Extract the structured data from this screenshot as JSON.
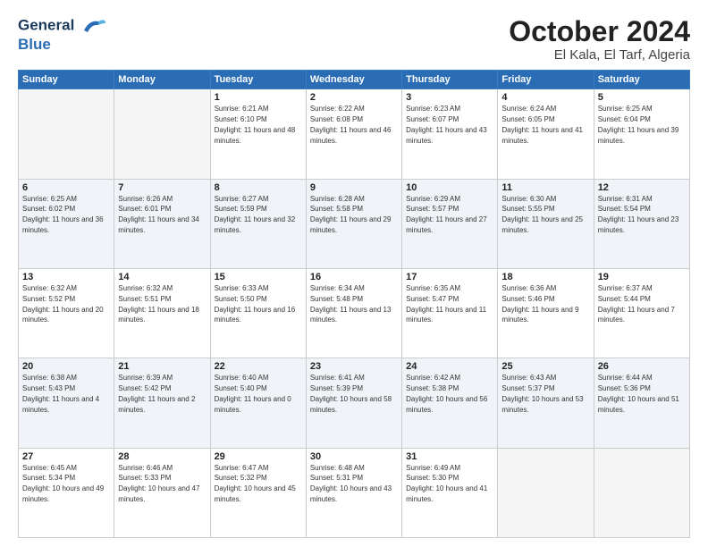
{
  "header": {
    "logo_line1": "General",
    "logo_line2": "Blue",
    "month": "October 2024",
    "location": "El Kala, El Tarf, Algeria"
  },
  "weekdays": [
    "Sunday",
    "Monday",
    "Tuesday",
    "Wednesday",
    "Thursday",
    "Friday",
    "Saturday"
  ],
  "weeks": [
    [
      {
        "day": "",
        "sunrise": "",
        "sunset": "",
        "daylight": "",
        "empty": true
      },
      {
        "day": "",
        "sunrise": "",
        "sunset": "",
        "daylight": "",
        "empty": true
      },
      {
        "day": "1",
        "sunrise": "Sunrise: 6:21 AM",
        "sunset": "Sunset: 6:10 PM",
        "daylight": "Daylight: 11 hours and 48 minutes.",
        "empty": false
      },
      {
        "day": "2",
        "sunrise": "Sunrise: 6:22 AM",
        "sunset": "Sunset: 6:08 PM",
        "daylight": "Daylight: 11 hours and 46 minutes.",
        "empty": false
      },
      {
        "day": "3",
        "sunrise": "Sunrise: 6:23 AM",
        "sunset": "Sunset: 6:07 PM",
        "daylight": "Daylight: 11 hours and 43 minutes.",
        "empty": false
      },
      {
        "day": "4",
        "sunrise": "Sunrise: 6:24 AM",
        "sunset": "Sunset: 6:05 PM",
        "daylight": "Daylight: 11 hours and 41 minutes.",
        "empty": false
      },
      {
        "day": "5",
        "sunrise": "Sunrise: 6:25 AM",
        "sunset": "Sunset: 6:04 PM",
        "daylight": "Daylight: 11 hours and 39 minutes.",
        "empty": false
      }
    ],
    [
      {
        "day": "6",
        "sunrise": "Sunrise: 6:25 AM",
        "sunset": "Sunset: 6:02 PM",
        "daylight": "Daylight: 11 hours and 36 minutes.",
        "empty": false
      },
      {
        "day": "7",
        "sunrise": "Sunrise: 6:26 AM",
        "sunset": "Sunset: 6:01 PM",
        "daylight": "Daylight: 11 hours and 34 minutes.",
        "empty": false
      },
      {
        "day": "8",
        "sunrise": "Sunrise: 6:27 AM",
        "sunset": "Sunset: 5:59 PM",
        "daylight": "Daylight: 11 hours and 32 minutes.",
        "empty": false
      },
      {
        "day": "9",
        "sunrise": "Sunrise: 6:28 AM",
        "sunset": "Sunset: 5:58 PM",
        "daylight": "Daylight: 11 hours and 29 minutes.",
        "empty": false
      },
      {
        "day": "10",
        "sunrise": "Sunrise: 6:29 AM",
        "sunset": "Sunset: 5:57 PM",
        "daylight": "Daylight: 11 hours and 27 minutes.",
        "empty": false
      },
      {
        "day": "11",
        "sunrise": "Sunrise: 6:30 AM",
        "sunset": "Sunset: 5:55 PM",
        "daylight": "Daylight: 11 hours and 25 minutes.",
        "empty": false
      },
      {
        "day": "12",
        "sunrise": "Sunrise: 6:31 AM",
        "sunset": "Sunset: 5:54 PM",
        "daylight": "Daylight: 11 hours and 23 minutes.",
        "empty": false
      }
    ],
    [
      {
        "day": "13",
        "sunrise": "Sunrise: 6:32 AM",
        "sunset": "Sunset: 5:52 PM",
        "daylight": "Daylight: 11 hours and 20 minutes.",
        "empty": false
      },
      {
        "day": "14",
        "sunrise": "Sunrise: 6:32 AM",
        "sunset": "Sunset: 5:51 PM",
        "daylight": "Daylight: 11 hours and 18 minutes.",
        "empty": false
      },
      {
        "day": "15",
        "sunrise": "Sunrise: 6:33 AM",
        "sunset": "Sunset: 5:50 PM",
        "daylight": "Daylight: 11 hours and 16 minutes.",
        "empty": false
      },
      {
        "day": "16",
        "sunrise": "Sunrise: 6:34 AM",
        "sunset": "Sunset: 5:48 PM",
        "daylight": "Daylight: 11 hours and 13 minutes.",
        "empty": false
      },
      {
        "day": "17",
        "sunrise": "Sunrise: 6:35 AM",
        "sunset": "Sunset: 5:47 PM",
        "daylight": "Daylight: 11 hours and 11 minutes.",
        "empty": false
      },
      {
        "day": "18",
        "sunrise": "Sunrise: 6:36 AM",
        "sunset": "Sunset: 5:46 PM",
        "daylight": "Daylight: 11 hours and 9 minutes.",
        "empty": false
      },
      {
        "day": "19",
        "sunrise": "Sunrise: 6:37 AM",
        "sunset": "Sunset: 5:44 PM",
        "daylight": "Daylight: 11 hours and 7 minutes.",
        "empty": false
      }
    ],
    [
      {
        "day": "20",
        "sunrise": "Sunrise: 6:38 AM",
        "sunset": "Sunset: 5:43 PM",
        "daylight": "Daylight: 11 hours and 4 minutes.",
        "empty": false
      },
      {
        "day": "21",
        "sunrise": "Sunrise: 6:39 AM",
        "sunset": "Sunset: 5:42 PM",
        "daylight": "Daylight: 11 hours and 2 minutes.",
        "empty": false
      },
      {
        "day": "22",
        "sunrise": "Sunrise: 6:40 AM",
        "sunset": "Sunset: 5:40 PM",
        "daylight": "Daylight: 11 hours and 0 minutes.",
        "empty": false
      },
      {
        "day": "23",
        "sunrise": "Sunrise: 6:41 AM",
        "sunset": "Sunset: 5:39 PM",
        "daylight": "Daylight: 10 hours and 58 minutes.",
        "empty": false
      },
      {
        "day": "24",
        "sunrise": "Sunrise: 6:42 AM",
        "sunset": "Sunset: 5:38 PM",
        "daylight": "Daylight: 10 hours and 56 minutes.",
        "empty": false
      },
      {
        "day": "25",
        "sunrise": "Sunrise: 6:43 AM",
        "sunset": "Sunset: 5:37 PM",
        "daylight": "Daylight: 10 hours and 53 minutes.",
        "empty": false
      },
      {
        "day": "26",
        "sunrise": "Sunrise: 6:44 AM",
        "sunset": "Sunset: 5:36 PM",
        "daylight": "Daylight: 10 hours and 51 minutes.",
        "empty": false
      }
    ],
    [
      {
        "day": "27",
        "sunrise": "Sunrise: 6:45 AM",
        "sunset": "Sunset: 5:34 PM",
        "daylight": "Daylight: 10 hours and 49 minutes.",
        "empty": false
      },
      {
        "day": "28",
        "sunrise": "Sunrise: 6:46 AM",
        "sunset": "Sunset: 5:33 PM",
        "daylight": "Daylight: 10 hours and 47 minutes.",
        "empty": false
      },
      {
        "day": "29",
        "sunrise": "Sunrise: 6:47 AM",
        "sunset": "Sunset: 5:32 PM",
        "daylight": "Daylight: 10 hours and 45 minutes.",
        "empty": false
      },
      {
        "day": "30",
        "sunrise": "Sunrise: 6:48 AM",
        "sunset": "Sunset: 5:31 PM",
        "daylight": "Daylight: 10 hours and 43 minutes.",
        "empty": false
      },
      {
        "day": "31",
        "sunrise": "Sunrise: 6:49 AM",
        "sunset": "Sunset: 5:30 PM",
        "daylight": "Daylight: 10 hours and 41 minutes.",
        "empty": false
      },
      {
        "day": "",
        "sunrise": "",
        "sunset": "",
        "daylight": "",
        "empty": true
      },
      {
        "day": "",
        "sunrise": "",
        "sunset": "",
        "daylight": "",
        "empty": true
      }
    ]
  ]
}
